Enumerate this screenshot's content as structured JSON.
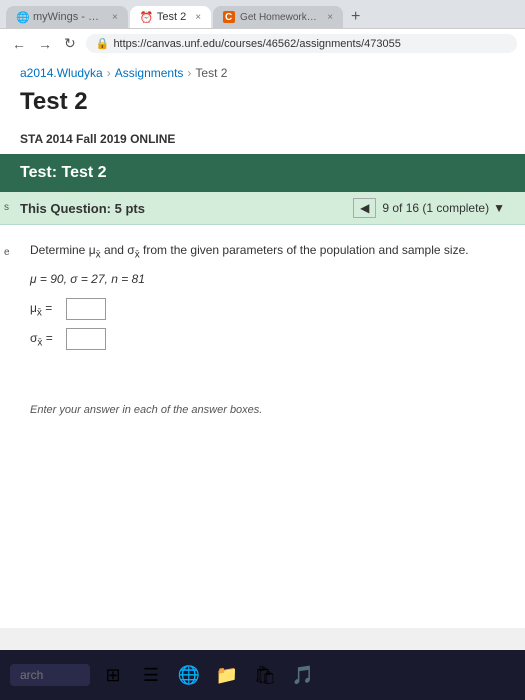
{
  "browser": {
    "tabs": [
      {
        "id": "tab1",
        "label": "myWings - UNF",
        "active": false,
        "icon": "🌐"
      },
      {
        "id": "tab2",
        "label": "Test 2",
        "active": true,
        "icon": "⏰"
      },
      {
        "id": "tab3",
        "label": "Get Homework Help With Che",
        "active": false,
        "icon": "C"
      }
    ],
    "address": "https://canvas.unf.edu/courses/46562/assignments/473055"
  },
  "breadcrumb": {
    "parts": [
      {
        "text": "a2014.Wludyka",
        "link": true
      },
      {
        "text": "Assignments",
        "link": true
      },
      {
        "text": "Test 2",
        "link": false
      }
    ]
  },
  "page": {
    "title": "Test 2",
    "course_label": "STA 2014 Fall 2019 ONLINE",
    "test_header": "Test: Test 2",
    "question": {
      "points_label": "This Question: 5 pts",
      "counter": "9 of 16 (1 complete)",
      "body": "Determine μᵥ and σᵥ from the given parameters of the population and sample size.",
      "params": "μ = 90, σ = 27, n = 81",
      "answers": [
        {
          "label": "μᵥ =",
          "value": ""
        },
        {
          "label": "σᵥ =",
          "value": ""
        }
      ],
      "footer": "Enter your answer in each of the answer boxes."
    }
  },
  "taskbar": {
    "search_placeholder": "arch",
    "icons": [
      "⊞",
      "☰",
      "🌐",
      "📁",
      "🔒"
    ]
  }
}
